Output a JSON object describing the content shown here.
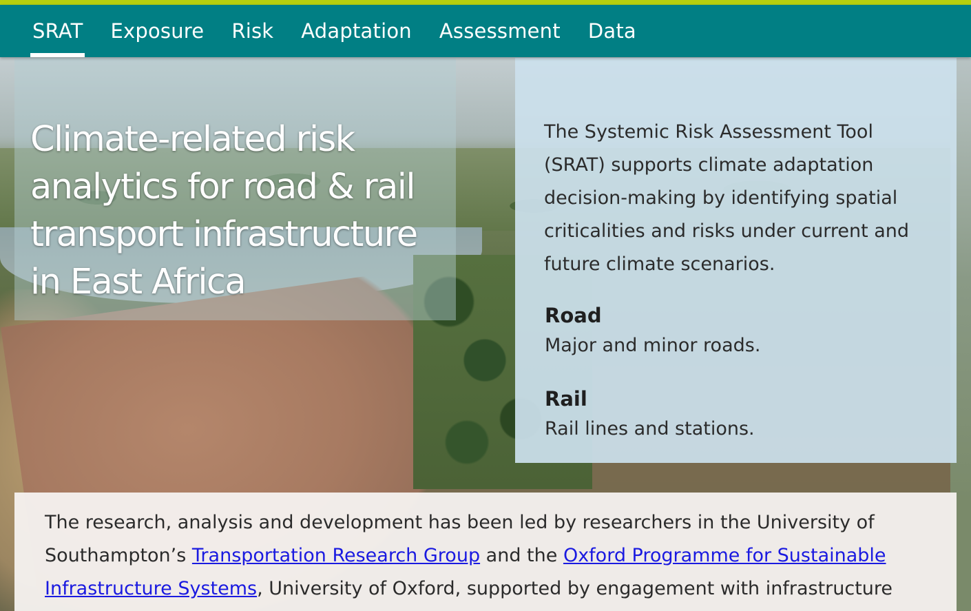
{
  "nav": {
    "items": [
      {
        "label": "SRAT",
        "active": true
      },
      {
        "label": "Exposure",
        "active": false
      },
      {
        "label": "Risk",
        "active": false
      },
      {
        "label": "Adaptation",
        "active": false
      },
      {
        "label": "Assessment",
        "active": false
      },
      {
        "label": "Data",
        "active": false
      }
    ]
  },
  "hero": {
    "title_line1": "Climate-related risk",
    "title_line2": "analytics for road & rail",
    "title_line3": "transport infrastructure",
    "title_line4": "in East Africa"
  },
  "info": {
    "intro_line1": "The Systemic Risk Assessment Tool",
    "intro_line2": "(SRAT) supports climate adaptation",
    "intro_line3": "decision-making by identifying spatial",
    "intro_line4": "criticalities and risks under current and",
    "intro_line5": "future climate scenarios.",
    "road_heading": "Road",
    "road_desc": "Major and minor roads.",
    "rail_heading": "Rail",
    "rail_desc": "Rail lines and stations."
  },
  "credits": {
    "text_before_link1": "The research, analysis and development has been led by researchers in the University of Southampton’s ",
    "link1": "Transportation Research Group",
    "text_between": " and the ",
    "link2": "Oxford Programme for Sustainable Infrastructure Systems",
    "text_after_link2": ", University of Oxford, supported by engagement with infrastructure and"
  },
  "colors": {
    "accent_bar": "#b7cf0e",
    "nav_background": "#017f84",
    "link": "#1a1ae0",
    "info_panel": "#cbe0ec"
  }
}
